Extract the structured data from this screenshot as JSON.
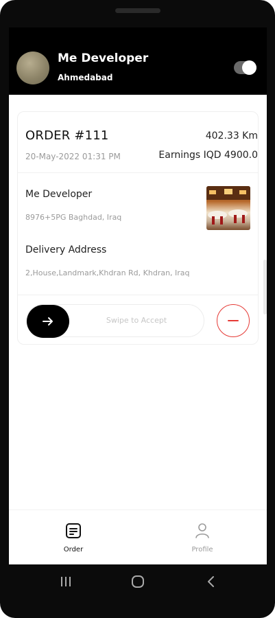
{
  "header": {
    "name": "Me Developer",
    "city": "Ahmedabad",
    "online_toggle": "on"
  },
  "order": {
    "title": "ORDER #111",
    "distance": "402.33 Km",
    "datetime": "20-May-2022 01:31 PM",
    "earnings": "Earnings IQD 4900.0",
    "store_name": "Me Developer",
    "store_address": "8976+5PG Baghdad, Iraq",
    "delivery_label": "Delivery Address",
    "delivery_address": "2,House,Landmark,Khdran Rd, Khdran, Iraq",
    "swipe_text": "Swipe to Accept"
  },
  "nav": {
    "items": [
      {
        "label": "Order",
        "active": true,
        "icon": "order-icon"
      },
      {
        "label": "Profile",
        "active": false,
        "icon": "profile-icon"
      }
    ]
  },
  "colors": {
    "accent": "#000000",
    "reject": "#e53935",
    "muted": "#9a9a9a"
  }
}
